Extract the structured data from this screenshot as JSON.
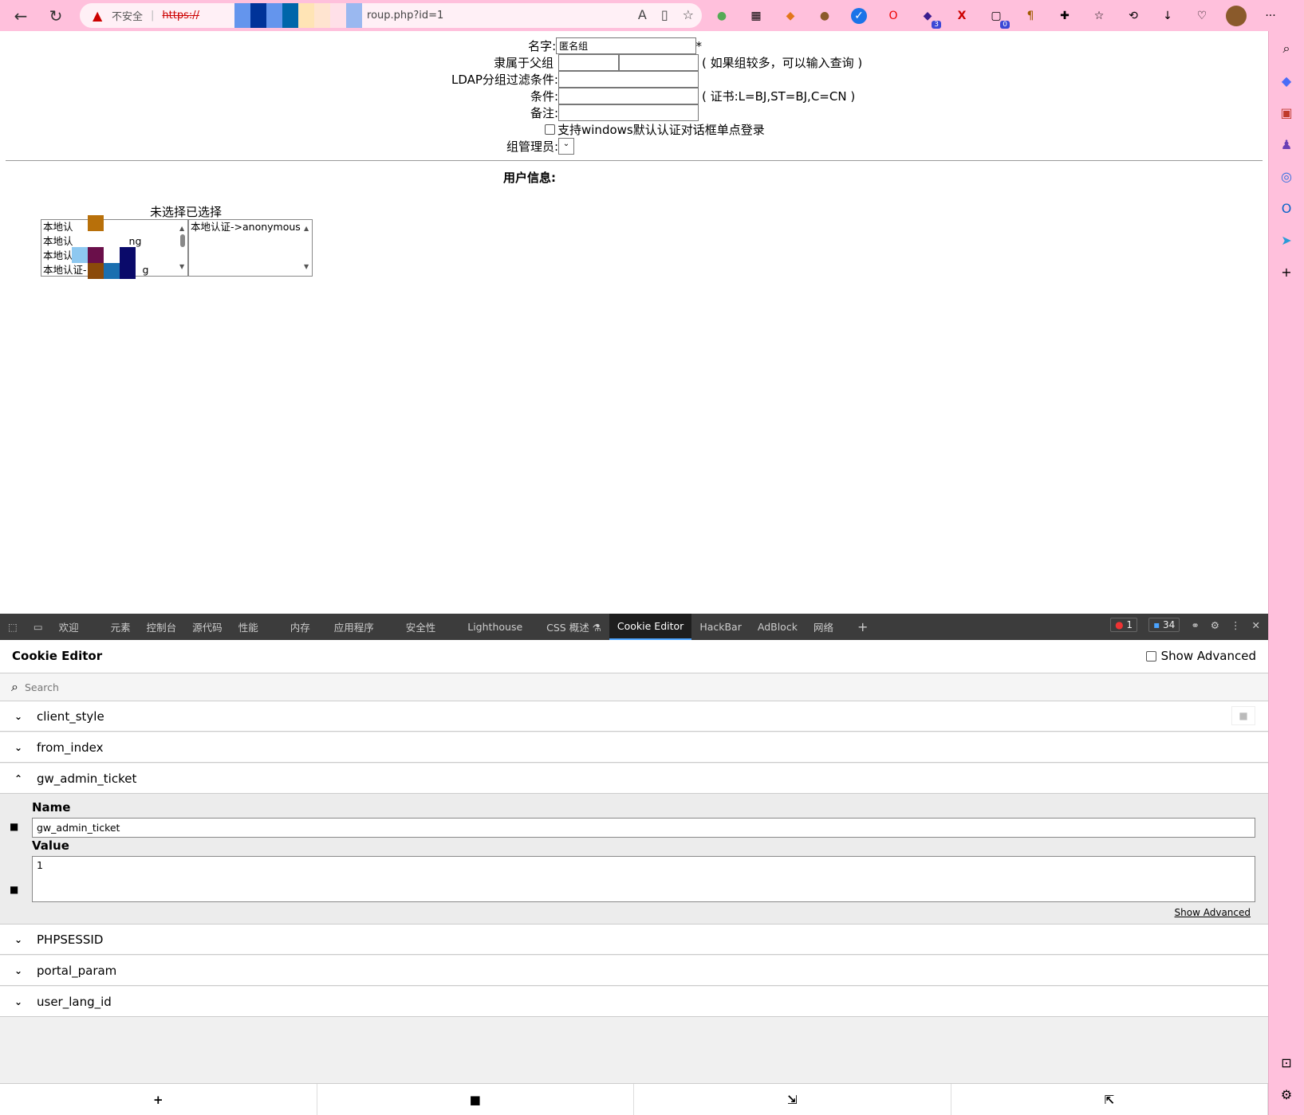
{
  "browser": {
    "security_label": "不安全",
    "url_scheme": "https://",
    "url_path": "roup.php?id=1",
    "redaction_colors": [
      "#6495ED",
      "#003399",
      "#6495ED",
      "#0066AA",
      "#FFE4B5",
      "#FFE4D0",
      "#FFE0E8",
      "#9AB8F0"
    ],
    "extension_icons": [
      "circle-icon",
      "calculator-icon",
      "metamask-icon",
      "cookie-icon",
      "check-icon",
      "opera-icon",
      "cube-icon",
      "x-icon",
      "counter-icon",
      "paragraph-icon",
      "puzzle-icon",
      "favorites-icon",
      "history-icon",
      "download-icon",
      "heart-icon",
      "avatar"
    ],
    "extension_badges": {
      "cube-icon": "3",
      "counter-icon": "0"
    },
    "toolbar_more": "···"
  },
  "form": {
    "name_label": "名字:",
    "name_value": "匿名组",
    "required_mark": "*",
    "parent_label": "隶属于父组",
    "parent_note": "( 如果组较多，可以输入查询 )",
    "ldap_label": "LDAP分组过滤条件:",
    "condition_label": "条件:",
    "condition_note": "( 证书:L=BJ,ST=BJ,C=CN )",
    "remark_label": "备注:",
    "windows_sso_label": "支持windows默认认证对话框单点登录",
    "admin_label": "组管理员:"
  },
  "users": {
    "section_title": "用户信息:",
    "header": "未选择已选择",
    "unselected": [
      "本地认",
      "本地认",
      "本地认",
      "本地认证-"
    ],
    "unselected_suffix": [
      "",
      "ng",
      "",
      "g"
    ],
    "selected": [
      "本地认证->anonymous"
    ]
  },
  "devtools": {
    "tabs": [
      "欢迎",
      "元素",
      "控制台",
      "源代码",
      "性能",
      "内存",
      "应用程序",
      "安全性",
      "Lighthouse",
      "CSS 概述 ⚗",
      "Cookie Editor",
      "HackBar",
      "AdBlock",
      "网络"
    ],
    "active_tab": "Cookie Editor",
    "errors": "1",
    "messages": "34"
  },
  "cookie_editor": {
    "title": "Cookie Editor",
    "show_advanced": "Show Advanced",
    "search_placeholder": "Search",
    "cookies": [
      "client_style",
      "from_index",
      "gw_admin_ticket",
      "PHPSESSID",
      "portal_param",
      "user_lang_id"
    ],
    "expanded": {
      "name_label": "Name",
      "name_value": "gw_admin_ticket",
      "value_label": "Value",
      "value_value": "1",
      "show_advanced_link": "Show Advanced"
    }
  }
}
